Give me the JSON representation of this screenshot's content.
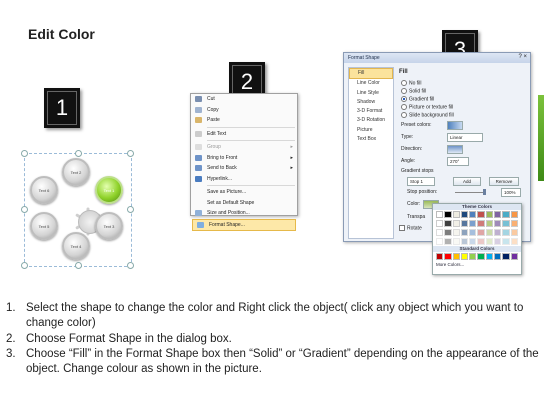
{
  "page": {
    "title": "Edit Color"
  },
  "steps": [
    "1",
    "2",
    "3"
  ],
  "diagram": {
    "center_node": "Text 1",
    "nodes": [
      "Text 6",
      "Text 2",
      "Text 1",
      "Text 5",
      "Text 3",
      "Text 4"
    ],
    "highlight_color": "#8fd22a"
  },
  "context_menu": {
    "items": [
      "Cut",
      "Copy",
      "Paste",
      "Edit Text",
      "Group",
      "Bring to Front",
      "Send to Back",
      "Hyperlink...",
      "Save as Picture...",
      "Set as Default Shape",
      "Size and Position...",
      "Format Shape..."
    ],
    "selected": "Format Shape..."
  },
  "format_dialog": {
    "title": "Format Shape",
    "close": "?  ×",
    "categories": [
      "Fill",
      "Line Color",
      "Line Style",
      "Shadow",
      "3-D Format",
      "3-D Rotation",
      "Picture",
      "Text Box"
    ],
    "selected_category": "Fill",
    "section": "Fill",
    "options": [
      "No fill",
      "Solid fill",
      "Gradient fill",
      "Picture or texture fill",
      "Slide background fill"
    ],
    "selected_option": "Gradient fill",
    "preset_colors": "Preset colors:",
    "type_label": "Type:",
    "type_value": "Linear",
    "direction_label": "Direction:",
    "angle_label": "Angle:",
    "angle_value": "270°",
    "gradient_stops": "Gradient stops",
    "stop_value": "Stop 1",
    "add_btn": "Add",
    "remove_btn": "Remove",
    "stop_position_label": "Stop position:",
    "stop_position_value": "100%",
    "color_label": "Color:",
    "transparency_label": "Transpa",
    "rotate_label": "Rotate"
  },
  "color_palette": {
    "theme_header": "Theme Colors",
    "standard_header": "Standard Colors",
    "more": "More Colors...",
    "theme_colors": [
      "#ffffff",
      "#000000",
      "#eeece1",
      "#1f497d",
      "#4f81bd",
      "#c0504d",
      "#9bbb59",
      "#8064a2",
      "#4bacc6",
      "#f79646"
    ],
    "standard_colors": [
      "#c00000",
      "#ff0000",
      "#ffc000",
      "#ffff00",
      "#92d050",
      "#00b050",
      "#00b0f0",
      "#0070c0",
      "#002060",
      "#7030a0"
    ]
  },
  "instructions": [
    {
      "num": "1.",
      "text": "Select the shape to change the color and Right click the object( click any object which you want to change color)"
    },
    {
      "num": "2.",
      "text": "Choose Format Shape in the dialog box."
    },
    {
      "num": "3.",
      "text": "Choose “Fill” in the Format Shape box then “Solid” or “Gradient” depending on the appearance of the object. Change colour as shown in the picture."
    }
  ]
}
